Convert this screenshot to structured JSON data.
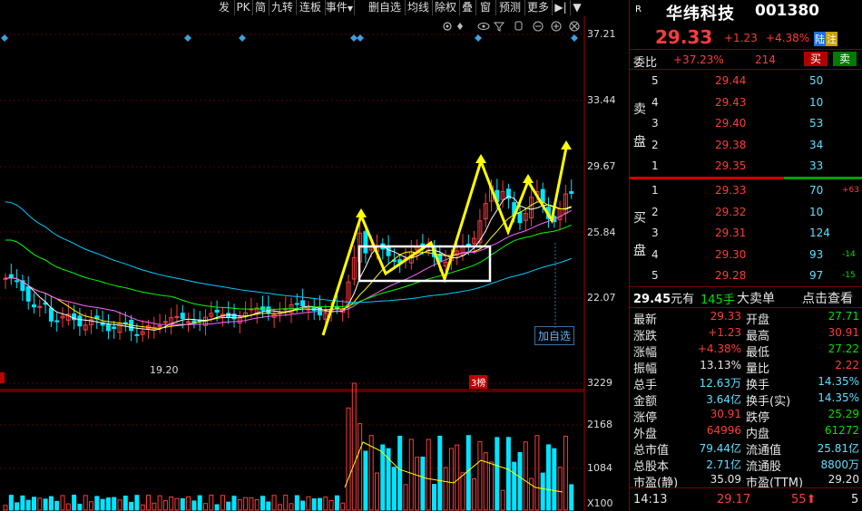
{
  "toolbar": {
    "items": [
      "发",
      "PK",
      "简",
      "九转",
      "连板",
      "事件",
      "删自选",
      "均线",
      "除权",
      "叠",
      "窗",
      "预测",
      "更多"
    ]
  },
  "price_axis": [
    "37.21",
    "33.44",
    "29.67",
    "25.84",
    "22.07"
  ],
  "volume_axis": [
    "3229",
    "2168",
    "1084",
    "X100"
  ],
  "chart": {
    "low_label": "19.20",
    "marker_label": "3榜",
    "add_watch_label": "加自选"
  },
  "quote": {
    "market_badge": "R",
    "name": "华纬科技",
    "code": "001380",
    "price": "29.33",
    "change": "+1.23",
    "change_pct": "+4.38%",
    "tag1": "陆",
    "tag2": "注",
    "weibi_label": "委比",
    "weibi_value": "+37.23%",
    "weicha_value": "214",
    "buy_button": "买",
    "sell_button": "卖"
  },
  "sell_side": {
    "label_top": "卖",
    "label_bottom": "盘",
    "levels": [
      {
        "n": "5",
        "price": "29.44",
        "vol": "50",
        "extra": ""
      },
      {
        "n": "4",
        "price": "29.43",
        "vol": "10",
        "extra": ""
      },
      {
        "n": "3",
        "price": "29.40",
        "vol": "53",
        "extra": ""
      },
      {
        "n": "2",
        "price": "29.38",
        "vol": "34",
        "extra": ""
      },
      {
        "n": "1",
        "price": "29.35",
        "vol": "33",
        "extra": ""
      }
    ]
  },
  "buy_side": {
    "label_top": "买",
    "label_bottom": "盘",
    "levels": [
      {
        "n": "1",
        "price": "29.33",
        "vol": "70",
        "extra": "+63"
      },
      {
        "n": "2",
        "price": "29.32",
        "vol": "10",
        "extra": ""
      },
      {
        "n": "3",
        "price": "29.31",
        "vol": "124",
        "extra": ""
      },
      {
        "n": "4",
        "price": "29.30",
        "vol": "93",
        "extra": "-14"
      },
      {
        "n": "5",
        "price": "29.28",
        "vol": "97",
        "extra": "-15"
      }
    ]
  },
  "big_order": {
    "price": "29.45",
    "unit": "元有",
    "qty": "145手",
    "desc": "大卖单",
    "action": "点击查看"
  },
  "stats": [
    {
      "l1": "最新",
      "v1": "29.33",
      "c1": "red",
      "l2": "开盘",
      "v2": "27.71",
      "c2": "green"
    },
    {
      "l1": "涨跌",
      "v1": "+1.23",
      "c1": "red",
      "l2": "最高",
      "v2": "30.91",
      "c2": "red"
    },
    {
      "l1": "涨幅",
      "v1": "+4.38%",
      "c1": "red",
      "l2": "最低",
      "v2": "27.22",
      "c2": "green"
    },
    {
      "l1": "振幅",
      "v1": "13.13%",
      "c1": "white",
      "l2": "量比",
      "v2": "2.22",
      "c2": "red"
    },
    {
      "l1": "总手",
      "v1": "12.63万",
      "c1": "cyan",
      "l2": "换手",
      "v2": "14.35%",
      "c2": "cyan"
    },
    {
      "l1": "金额",
      "v1": "3.64亿",
      "c1": "cyan",
      "l2": "换手(实)",
      "v2": "14.35%",
      "c2": "cyan"
    },
    {
      "l1": "涨停",
      "v1": "30.91",
      "c1": "red",
      "l2": "跌停",
      "v2": "25.29",
      "c2": "green"
    },
    {
      "l1": "外盘",
      "v1": "64996",
      "c1": "red",
      "l2": "内盘",
      "v2": "61272",
      "c2": "green"
    },
    {
      "l1": "总市值",
      "v1": "79.44亿",
      "c1": "cyan",
      "l2": "流通值",
      "v2": "25.81亿",
      "c2": "cyan"
    },
    {
      "l1": "总股本",
      "v1": "2.71亿",
      "c1": "cyan",
      "l2": "流通股",
      "v2": "8800万",
      "c2": "cyan"
    },
    {
      "l1": "市盈(静)",
      "v1": "35.09",
      "c1": "white",
      "l2": "市盈(TTM)",
      "v2": "29.20",
      "c2": "white"
    }
  ],
  "tick": {
    "time": "14:13",
    "price": "29.17",
    "vol": "55",
    "num": "5"
  },
  "colors": {
    "up": "#ff3b3b",
    "down": "#00e5ff",
    "ma5": "#ffffff",
    "ma10": "#ffff00",
    "ma20": "#ff66ff",
    "ma30": "#00ff00",
    "ma60": "#00ccff",
    "annotation": "#ffff00"
  }
}
